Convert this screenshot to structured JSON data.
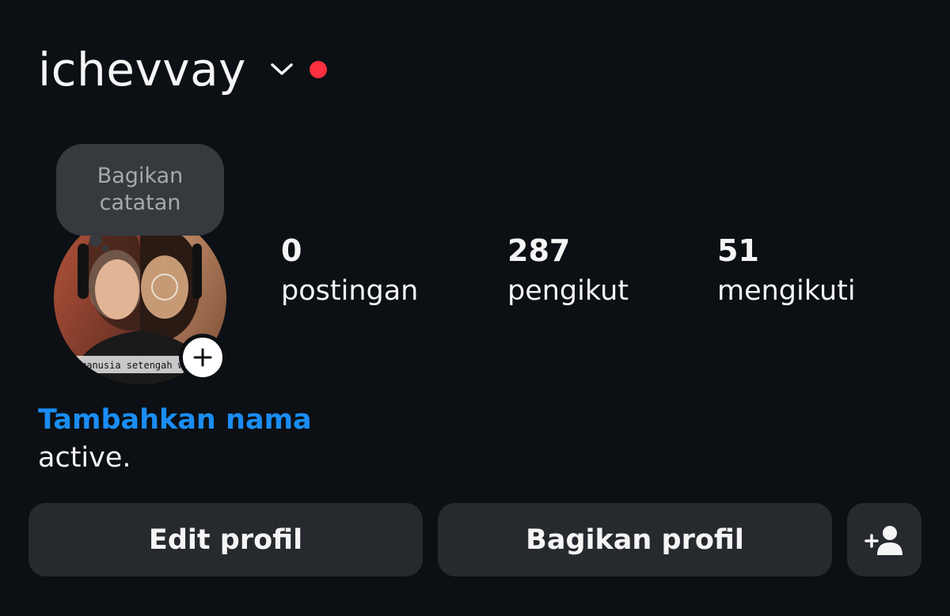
{
  "header": {
    "username": "ichevvay"
  },
  "note": {
    "line1": "Bagikan",
    "line2": "catatan"
  },
  "avatar": {
    "caption": "manusia setengah w"
  },
  "stats": [
    {
      "value": "0",
      "label": "postingan"
    },
    {
      "value": "287",
      "label": "pengikut"
    },
    {
      "value": "51",
      "label": "mengikuti"
    }
  ],
  "profile": {
    "add_name": "Tambahkan nama",
    "bio": "active."
  },
  "buttons": {
    "edit": "Edit profil",
    "share": "Bagikan profil"
  },
  "icons": {
    "account_switch": "chevron-down-icon",
    "notification": "red-dot",
    "add_story": "plus-icon",
    "discover_people": "add-person-icon"
  },
  "colors": {
    "background": "#0c1014",
    "link": "#1a8df5",
    "notification": "#ff3040",
    "button": "#262a2f"
  }
}
